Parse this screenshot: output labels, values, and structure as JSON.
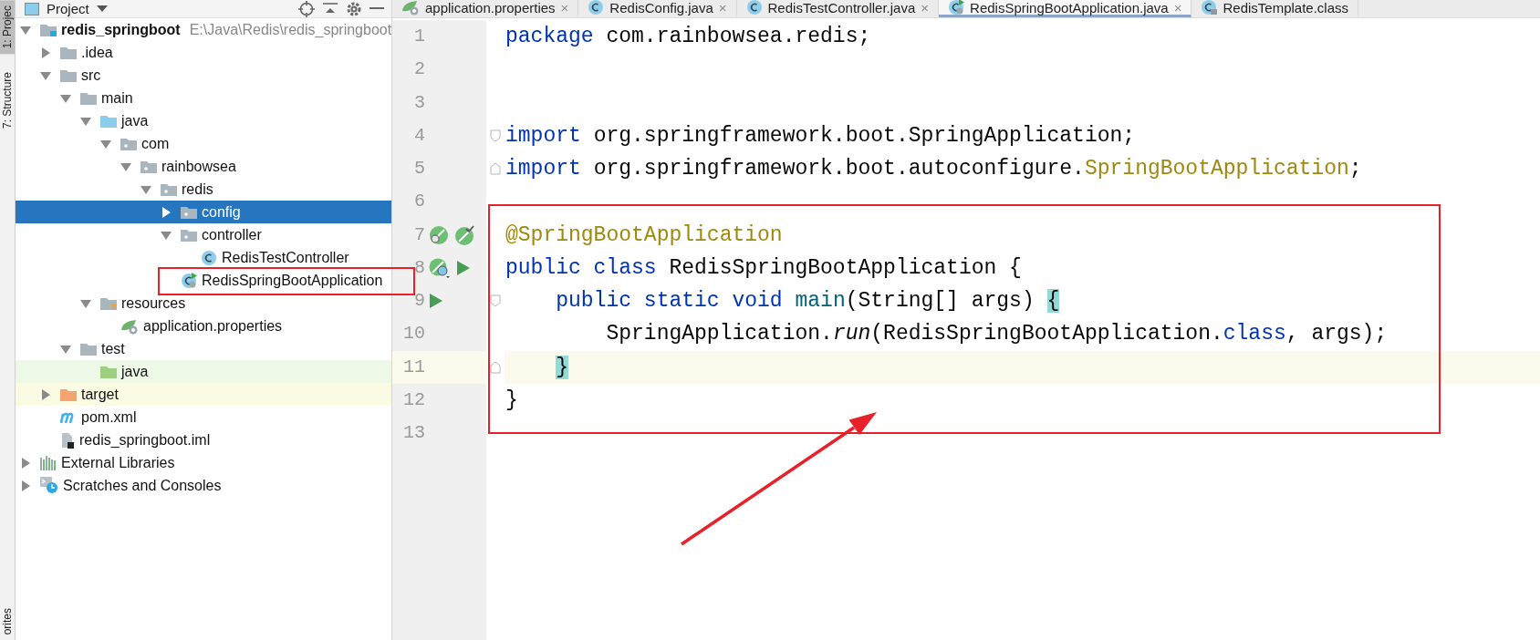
{
  "tool_stripe": [
    {
      "label": "1: Projec",
      "selected": true
    },
    {
      "label": "7: Structure",
      "selected": false
    },
    {
      "label": "orites",
      "selected": false
    }
  ],
  "project_panel": {
    "title": "Project",
    "tree": [
      {
        "label": "redis_springboot",
        "path": "E:\\Java\\Redis\\redis_springboot",
        "kind": "module",
        "expanded": true,
        "selected": false,
        "children": [
          {
            "label": ".idea",
            "kind": "folder",
            "expanded": false,
            "selected": false
          },
          {
            "label": "src",
            "kind": "folder",
            "expanded": true,
            "selected": false,
            "children": [
              {
                "label": "main",
                "kind": "folder",
                "expanded": true,
                "selected": false,
                "children": [
                  {
                    "label": "java",
                    "kind": "source-folder",
                    "expanded": true,
                    "selected": false,
                    "children": [
                      {
                        "label": "com",
                        "kind": "package",
                        "expanded": true,
                        "selected": false,
                        "children": [
                          {
                            "label": "rainbowsea",
                            "kind": "package",
                            "expanded": true,
                            "selected": false,
                            "children": [
                              {
                                "label": "redis",
                                "kind": "package",
                                "expanded": true,
                                "selected": false,
                                "children": [
                                  {
                                    "label": "config",
                                    "kind": "package",
                                    "expanded": false,
                                    "selected": true
                                  },
                                  {
                                    "label": "controller",
                                    "kind": "package",
                                    "expanded": true,
                                    "selected": false,
                                    "children": [
                                      {
                                        "label": "RedisTestController",
                                        "kind": "class",
                                        "selected": false
                                      }
                                    ]
                                  },
                                  {
                                    "label": "RedisSpringBootApplication",
                                    "kind": "spring-class",
                                    "selected": false
                                  }
                                ]
                              }
                            ]
                          }
                        ]
                      }
                    ]
                  },
                  {
                    "label": "resources",
                    "kind": "resources-folder",
                    "expanded": true,
                    "selected": false,
                    "children": [
                      {
                        "label": "application.properties",
                        "kind": "properties",
                        "selected": false
                      }
                    ]
                  }
                ]
              },
              {
                "label": "test",
                "kind": "folder",
                "expanded": true,
                "selected": false,
                "children": [
                  {
                    "label": "java",
                    "kind": "test-folder",
                    "selected": false
                  }
                ]
              }
            ]
          },
          {
            "label": "target",
            "kind": "excluded-folder",
            "expanded": false,
            "selected": false
          },
          {
            "label": "pom.xml",
            "kind": "maven",
            "selected": false
          },
          {
            "label": "redis_springboot.iml",
            "kind": "iml",
            "selected": false
          }
        ]
      },
      {
        "label": "External Libraries",
        "kind": "libraries",
        "expanded": false,
        "selected": false
      },
      {
        "label": "Scratches and Consoles",
        "kind": "scratches",
        "expanded": false,
        "selected": false
      }
    ]
  },
  "editor": {
    "tabs": [
      {
        "label": "application.properties",
        "kind": "properties",
        "selected": false,
        "close": "×"
      },
      {
        "label": "RedisConfig.java",
        "kind": "class",
        "selected": false,
        "close": "×"
      },
      {
        "label": "RedisTestController.java",
        "kind": "class",
        "selected": false,
        "close": "×"
      },
      {
        "label": "RedisSpringBootApplication.java",
        "kind": "spring-class",
        "selected": true,
        "close": "×"
      },
      {
        "label": "RedisTemplate.class",
        "kind": "library-class",
        "selected": false
      }
    ],
    "lines": [
      {
        "number": "1",
        "current": false,
        "tokens": [
          {
            "text": "package ",
            "kind": "keyword"
          },
          {
            "text": "com.rainbowsea.redis;",
            "kind": "plain"
          }
        ]
      },
      {
        "number": "2",
        "current": false
      },
      {
        "number": "3",
        "current": false
      },
      {
        "number": "4",
        "current": false,
        "marks": [
          {
            "kind": "fold-start"
          }
        ],
        "tokens": [
          {
            "text": "import ",
            "kind": "keyword"
          },
          {
            "text": "org.springframework.boot.SpringApplication;",
            "kind": "plain"
          }
        ]
      },
      {
        "number": "5",
        "current": false,
        "marks": [
          {
            "kind": "fold-end"
          }
        ],
        "tokens": [
          {
            "text": "import ",
            "kind": "keyword"
          },
          {
            "text": "org.springframework.boot.autoconfigure.",
            "kind": "plain"
          },
          {
            "text": "SpringBootApplication",
            "kind": "annotation"
          },
          {
            "text": ";",
            "kind": "plain"
          }
        ]
      },
      {
        "number": "6",
        "current": false
      },
      {
        "number": "7",
        "current": false,
        "marks": [
          {
            "kind": "leaf-search"
          },
          {
            "kind": "leaf-check"
          }
        ],
        "tokens": [
          {
            "text": "@SpringBootApplication",
            "kind": "annotation"
          }
        ]
      },
      {
        "number": "8",
        "current": false,
        "marks": [
          {
            "kind": "leaf-globe"
          },
          {
            "kind": "run"
          }
        ],
        "tokens": [
          {
            "text": "public class ",
            "kind": "keyword"
          },
          {
            "text": "RedisSpringBootApplication {",
            "kind": "plain"
          }
        ]
      },
      {
        "number": "9",
        "current": false,
        "marks": [
          {
            "kind": "run"
          },
          {
            "kind": "fold-start"
          }
        ],
        "tokens": [
          {
            "text": "    public static void ",
            "kind": "keyword"
          },
          {
            "text": "main",
            "kind": "declaration"
          },
          {
            "text": "(String[] args) ",
            "kind": "plain"
          },
          {
            "text": "{",
            "kind": "brace-match"
          }
        ]
      },
      {
        "number": "10",
        "current": false,
        "tokens": [
          {
            "text": "        SpringApplication.",
            "kind": "plain"
          },
          {
            "text": "run",
            "kind": "italic"
          },
          {
            "text": "(RedisSpringBootApplication.",
            "kind": "plain"
          },
          {
            "text": "class",
            "kind": "keyword"
          },
          {
            "text": ", args);",
            "kind": "plain"
          }
        ]
      },
      {
        "number": "11",
        "current": true,
        "marks": [
          {
            "kind": "fold-end"
          }
        ],
        "tokens": [
          {
            "text": "    }",
            "kind": "brace-match"
          }
        ]
      },
      {
        "number": "12",
        "current": false,
        "tokens": [
          {
            "text": "}",
            "kind": "plain"
          }
        ]
      },
      {
        "number": "13",
        "current": false
      }
    ]
  }
}
